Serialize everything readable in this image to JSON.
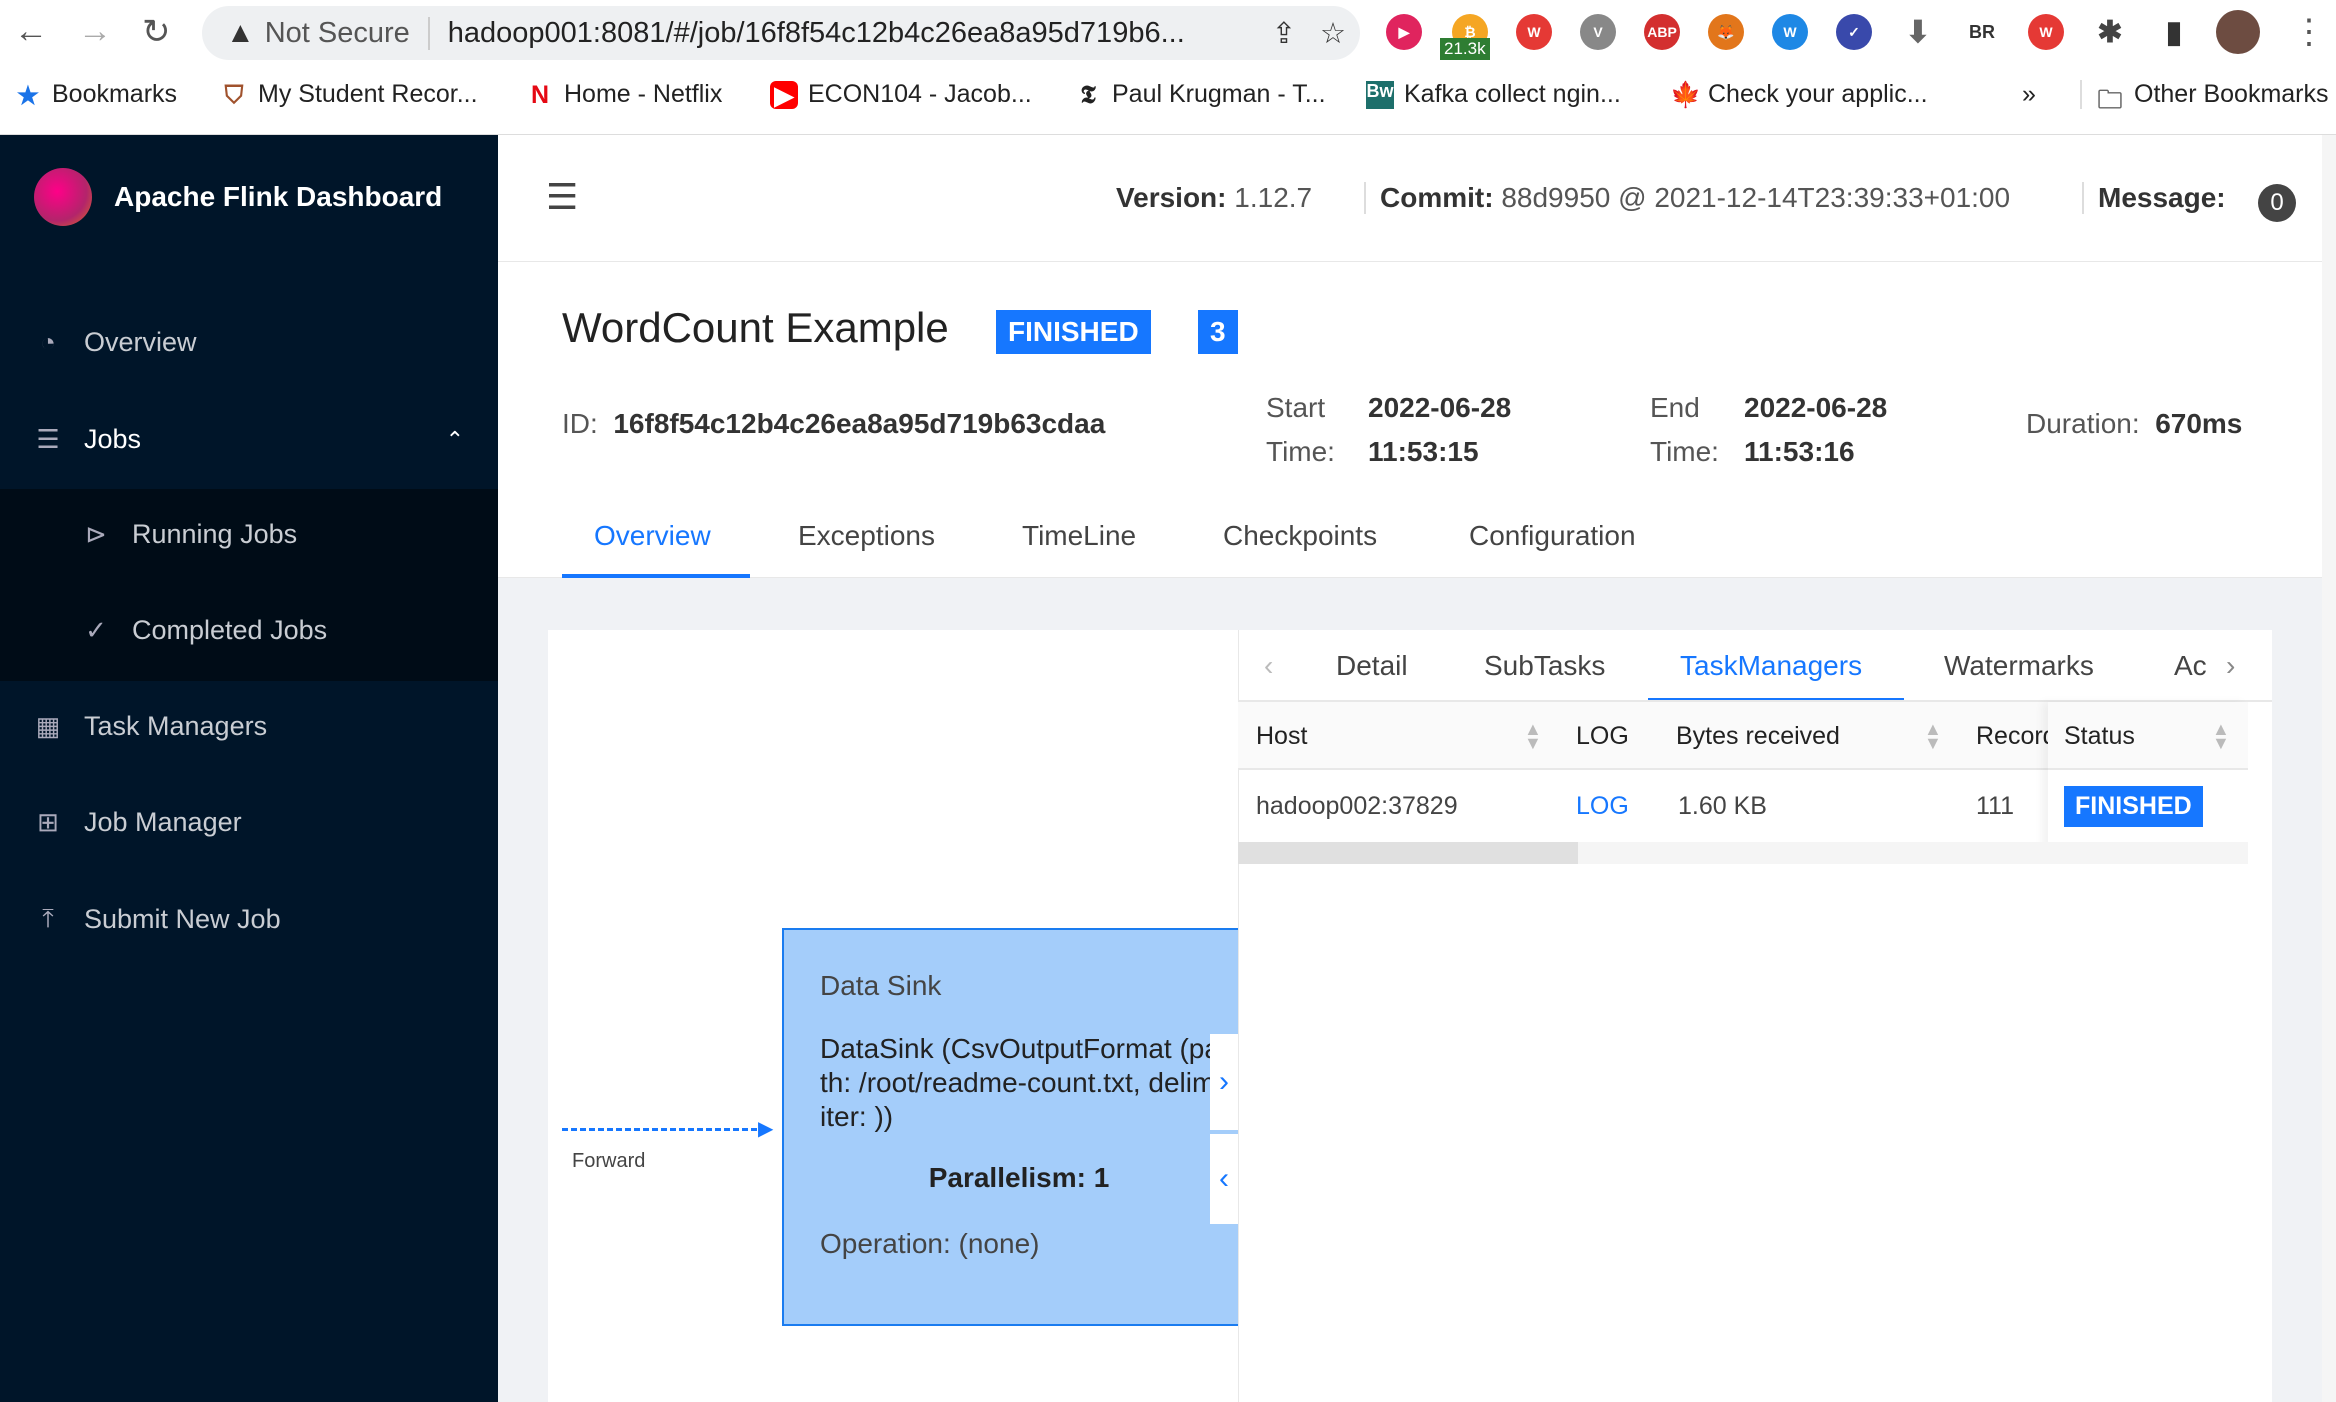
{
  "browser": {
    "security": "Not Secure",
    "url": "hadoop001:8081/#/job/16f8f54c12b4c26ea8a95d719b6...",
    "ext_badge": "21.3k",
    "ext_br": "BR",
    "bookmarks": [
      "Bookmarks",
      "My Student Recor...",
      "Home - Netflix",
      "ECON104 - Jacob...",
      "Paul Krugman - T...",
      "Kafka collect ngin...",
      "Check your applic..."
    ],
    "more": "»",
    "other": "Other Bookmarks"
  },
  "sidebar": {
    "title": "Apache Flink Dashboard",
    "items": [
      {
        "label": "Overview",
        "icon": "dashboard-icon"
      },
      {
        "label": "Jobs",
        "icon": "list-icon"
      },
      {
        "label": "Running Jobs",
        "icon": "play-circle-icon"
      },
      {
        "label": "Completed Jobs",
        "icon": "check-circle-icon"
      },
      {
        "label": "Task Managers",
        "icon": "schedule-icon"
      },
      {
        "label": "Job Manager",
        "icon": "build-icon"
      },
      {
        "label": "Submit New Job",
        "icon": "upload-icon"
      }
    ]
  },
  "header": {
    "version_label": "Version:",
    "version": "1.12.7",
    "commit_label": "Commit:",
    "commit": "88d9950 @ 2021-12-14T23:39:33+01:00",
    "message_label": "Message:",
    "message_count": "0"
  },
  "job": {
    "name": "WordCount Example",
    "status": "FINISHED",
    "parallelism": "3",
    "id_label": "ID:",
    "id": "16f8f54c12b4c26ea8a95d719b63cdaa",
    "start_label1": "Start",
    "start_label2": "Time:",
    "start_date": "2022-06-28",
    "start_time": "11:53:15",
    "end_label1": "End",
    "end_label2": "Time:",
    "end_date": "2022-06-28",
    "end_time": "11:53:16",
    "duration_label": "Duration:",
    "duration": "670ms"
  },
  "tabs": [
    "Overview",
    "Exceptions",
    "TimeLine",
    "Checkpoints",
    "Configuration"
  ],
  "graph": {
    "edge_label": "Forward",
    "node": {
      "title": "Data Sink",
      "desc": "DataSink (CsvOutputFormat (path: /root/readme-count.txt, delimiter: ))",
      "parallelism": "Parallelism: 1",
      "operation": "Operation: (none)"
    }
  },
  "panel": {
    "tabs": [
      "Detail",
      "SubTasks",
      "TaskManagers",
      "Watermarks",
      "Ac"
    ],
    "columns": [
      "Host",
      "LOG",
      "Bytes received",
      "Records",
      "Status"
    ],
    "rows": [
      {
        "host": "hadoop002:37829",
        "log": "LOG",
        "bytes": "1.60 KB",
        "records": "111",
        "status": "FINISHED"
      }
    ]
  },
  "colors": {
    "accent": "#1677ff",
    "sidebar": "#001529",
    "node": "#a4cdfa"
  }
}
